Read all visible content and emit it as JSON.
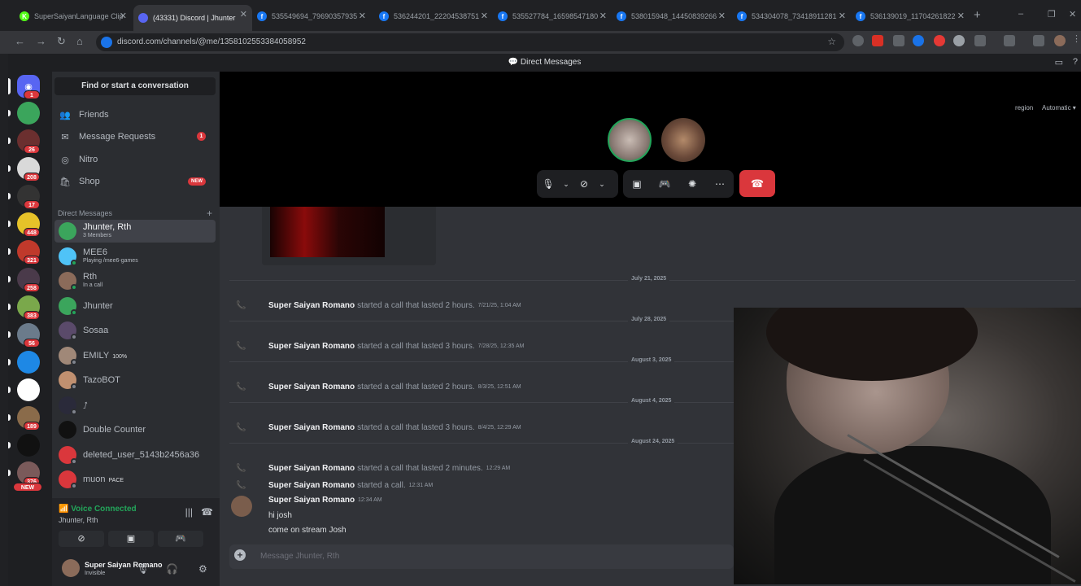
{
  "browser": {
    "tabs": [
      {
        "title": "SuperSaiyanLanguage Clip",
        "fav_color": "#53fc18",
        "fav_glyph": "K"
      },
      {
        "title": "(43331) Discord | Jhunter",
        "fav_color": "#5865f2",
        "fav_glyph": "",
        "active": true
      },
      {
        "title": "535549694_79690357935",
        "fav_color": "#1877f2",
        "fav_glyph": "f"
      },
      {
        "title": "536244201_22204538751",
        "fav_color": "#1877f2",
        "fav_glyph": "f"
      },
      {
        "title": "535527784_16598547180",
        "fav_color": "#1877f2",
        "fav_glyph": "f"
      },
      {
        "title": "538015948_14450839266",
        "fav_color": "#1877f2",
        "fav_glyph": "f"
      },
      {
        "title": "534304078_73418911281",
        "fav_color": "#1877f2",
        "fav_glyph": "f"
      },
      {
        "title": "536139019_11704261822",
        "fav_color": "#1877f2",
        "fav_glyph": "f"
      }
    ],
    "url": "discord.com/channels/@me/1358102553384058952"
  },
  "titlebar": {
    "title": "Direct Messages"
  },
  "guilds": [
    {
      "badge": "1",
      "color": "#5865f2"
    },
    {
      "badge": "",
      "color": "#3ba55c"
    },
    {
      "badge": "26",
      "color": "#6b2f2f"
    },
    {
      "badge": "208",
      "color": "#d9d9d9"
    },
    {
      "badge": "17",
      "color": "#333333"
    },
    {
      "badge": "448",
      "color": "#e6c229"
    },
    {
      "badge": "321",
      "color": "#c0392b"
    },
    {
      "badge": "258",
      "color": "#4a3a4a"
    },
    {
      "badge": "383",
      "color": "#7aa84b"
    },
    {
      "badge": "56",
      "color": "#6b7b8b"
    },
    {
      "badge": "",
      "color": "#1e88e5"
    },
    {
      "badge": "",
      "color": "#ffffff"
    },
    {
      "badge": "189",
      "color": "#8a6b4a"
    },
    {
      "badge": "",
      "color": "#111111"
    },
    {
      "badge": "376",
      "color": "#7a5a5a"
    }
  ],
  "guild_new": "NEW",
  "sidebar": {
    "search": "Find or start a conversation",
    "nav": [
      {
        "label": "Friends",
        "icon": "friends-icon",
        "glyph": "👥"
      },
      {
        "label": "Message Requests",
        "icon": "mail-icon",
        "glyph": "✉",
        "badge": "1"
      },
      {
        "label": "Nitro",
        "icon": "nitro-icon",
        "glyph": "◎"
      },
      {
        "label": "Shop",
        "icon": "shop-icon",
        "glyph": "🛍",
        "badge_new": "NEW"
      }
    ],
    "dm_header": "Direct Messages",
    "dms": [
      {
        "name": "Jhunter, Rth",
        "sub": "3 Members",
        "color": "#3ba55c",
        "status": "",
        "selected": true
      },
      {
        "name": "MEE6",
        "sub": "Playing /mee6-games",
        "color": "#4fc3f7",
        "status": "#23a55a"
      },
      {
        "name": "Rth",
        "sub": "In a call",
        "color": "#8b6b5a",
        "status": "#23a55a"
      },
      {
        "name": "Jhunter",
        "sub": "",
        "color": "#3ba55c",
        "status": "#23a55a"
      },
      {
        "name": "Sosaa",
        "sub": "",
        "color": "#5a4a6a",
        "status": "#80848e"
      },
      {
        "name": "EMILY",
        "tag": "100%",
        "sub": "",
        "color": "#a08878",
        "status": "#80848e"
      },
      {
        "name": "TazoBOT",
        "sub": "",
        "color": "#c09070",
        "status": "#80848e"
      },
      {
        "name": "⭜",
        "sub": "",
        "color": "#2a2a3a",
        "status": "#80848e"
      },
      {
        "name": "Double Counter",
        "sub": "",
        "color": "#111111",
        "status": ""
      },
      {
        "name": "deleted_user_5143b2456a36",
        "sub": "",
        "color": "#da373c",
        "status": "#80848e"
      },
      {
        "name": "muon",
        "tag": "PACE",
        "sub": "",
        "color": "#da373c",
        "status": "#80848e"
      }
    ]
  },
  "voice": {
    "status": "Voice Connected",
    "channel": "Jhunter, Rth"
  },
  "user": {
    "name": "Super Saiyan Romano",
    "status": "Invisible"
  },
  "call": {
    "region_label": "region",
    "region_value": "Automatic"
  },
  "chat": {
    "events": [
      {
        "type": "divider",
        "date": "July 21, 2025"
      },
      {
        "type": "call",
        "who": "Super Saiyan Romano",
        "what": "started a call that lasted 2 hours.",
        "when": "7/21/25, 1:04 AM"
      },
      {
        "type": "divider",
        "date": "July 28, 2025"
      },
      {
        "type": "call",
        "who": "Super Saiyan Romano",
        "what": "started a call that lasted 3 hours.",
        "when": "7/28/25, 12:35 AM"
      },
      {
        "type": "divider",
        "date": "August 3, 2025"
      },
      {
        "type": "call",
        "who": "Super Saiyan Romano",
        "what": "started a call that lasted 2 hours.",
        "when": "8/3/25, 12:51 AM"
      },
      {
        "type": "divider",
        "date": "August 4, 2025"
      },
      {
        "type": "call",
        "who": "Super Saiyan Romano",
        "what": "started a call that lasted 3 hours.",
        "when": "8/4/25, 12:29 AM"
      },
      {
        "type": "divider",
        "date": "August 24, 2025"
      },
      {
        "type": "call",
        "who": "Super Saiyan Romano",
        "what": "started a call that lasted 2 minutes.",
        "when": "12:29 AM"
      },
      {
        "type": "call",
        "who": "Super Saiyan Romano",
        "what": "started a call.",
        "when": "12:31 AM"
      }
    ],
    "message": {
      "author": "Super Saiyan Romano",
      "time": "12:34 AM",
      "lines": [
        "hi josh",
        "come on stream Josh"
      ]
    },
    "composer_placeholder": "Message Jhunter, Rth"
  }
}
